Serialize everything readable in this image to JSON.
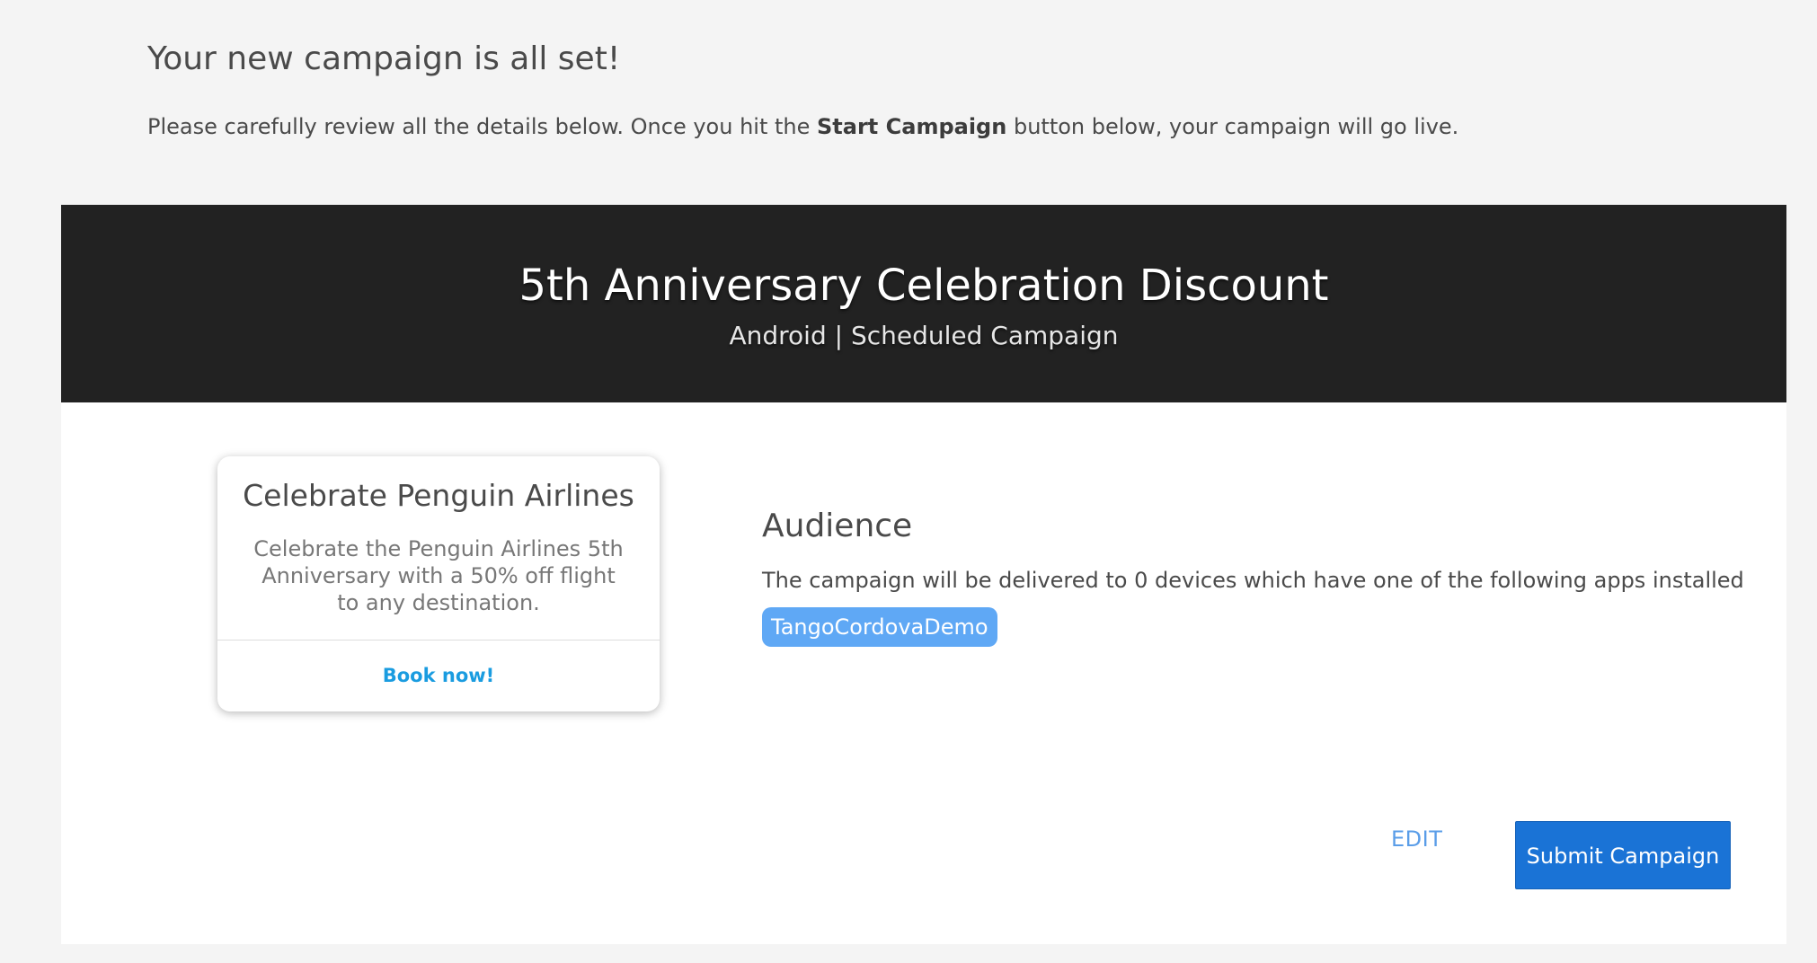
{
  "header": {
    "title": "Your new campaign is all set!",
    "intro_before": "Please carefully review all the details below. Once you hit the ",
    "intro_bold": "Start Campaign",
    "intro_after": " button below, your campaign will go live."
  },
  "campaign": {
    "name": "5th Anniversary Celebration Discount",
    "meta": "Android | Scheduled Campaign"
  },
  "preview": {
    "title": "Celebrate Penguin Airlines",
    "body": "Celebrate the Penguin Airlines 5th Anniversary with a 50% off flight to any destination.",
    "action_label": "Book now!"
  },
  "audience": {
    "heading": "Audience",
    "description": "The campaign will be delivered to 0 devices which have one of the following apps installed",
    "apps": [
      "TangoCordovaDemo"
    ]
  },
  "actions": {
    "edit_label": "EDIT",
    "submit_label": "Submit Campaign"
  },
  "colors": {
    "page_background": "#f4f4f4",
    "hero_background": "#222222",
    "link_blue": "#1a9ce0",
    "tag_blue": "#5fa8f5",
    "primary_button": "#1a73d6"
  }
}
